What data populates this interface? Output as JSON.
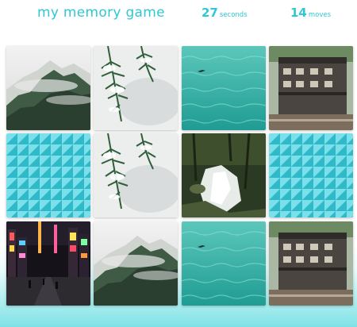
{
  "header": {
    "title": "my memory game",
    "time_value": "27",
    "time_unit": "seconds",
    "moves_value": "14",
    "moves_unit": "moves"
  },
  "colors": {
    "accent": "#2ec8d4",
    "card_back": "#3cc9d8"
  },
  "board": {
    "rows": 3,
    "cols": 4,
    "cards": [
      {
        "state": "revealed",
        "image": "misty-mountain"
      },
      {
        "state": "revealed",
        "image": "snowy-pine"
      },
      {
        "state": "revealed",
        "image": "turquoise-sea"
      },
      {
        "state": "revealed",
        "image": "wooden-building"
      },
      {
        "state": "face-down",
        "image": "card-back"
      },
      {
        "state": "revealed",
        "image": "snowy-pine"
      },
      {
        "state": "revealed",
        "image": "forest-waterfall"
      },
      {
        "state": "face-down",
        "image": "card-back"
      },
      {
        "state": "revealed",
        "image": "city-night-street"
      },
      {
        "state": "revealed",
        "image": "misty-mountain"
      },
      {
        "state": "revealed",
        "image": "turquoise-sea"
      },
      {
        "state": "revealed",
        "image": "wooden-building"
      }
    ]
  }
}
